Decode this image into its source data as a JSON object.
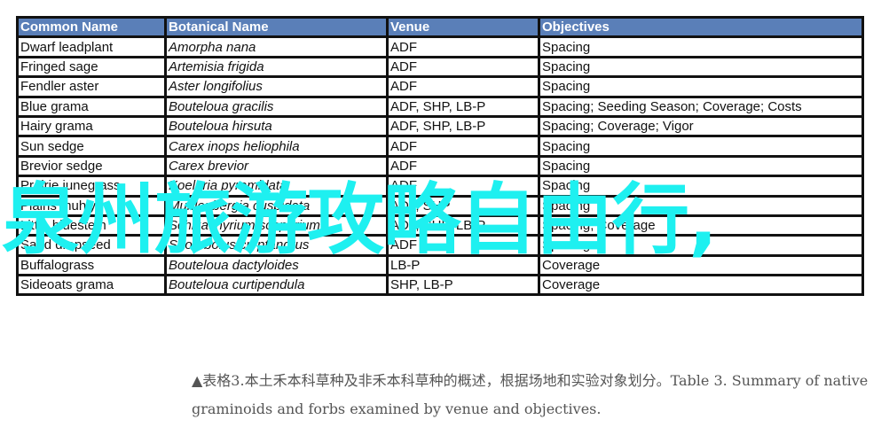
{
  "table": {
    "headers": [
      "Common Name",
      "Botanical  Name",
      "Venue",
      "Objectives"
    ],
    "rows": [
      [
        "Dwarf leadplant",
        "Amorpha nana",
        "ADF",
        "Spacing"
      ],
      [
        "Fringed sage",
        "Artemisia frigida",
        "ADF",
        "Spacing"
      ],
      [
        "Fendler aster",
        "Aster longifolius",
        "ADF",
        "Spacing"
      ],
      [
        "Blue grama",
        "Bouteloua gracilis",
        "ADF, SHP, LB-P",
        "Spacing; Seeding Season;  Coverage; Costs"
      ],
      [
        "Hairy grama",
        "Bouteloua hirsuta",
        "ADF, SHP, LB-P",
        "Spacing; Coverage; Vigor"
      ],
      [
        "Sun sedge",
        "Carex inops heliophila",
        "ADF",
        "Spacing"
      ],
      [
        "Brevior sedge",
        "Carex brevior",
        "ADF",
        "Spacing"
      ],
      [
        "Prairie junegrass",
        "Koeleria pyramidata",
        "ADF",
        "Spacing"
      ],
      [
        "Plains muhly",
        "Muhlenbergia cuspidata",
        "ADF, SHP",
        "Spacing"
      ],
      [
        "Little bluestem",
        "Schizachyrium scoparium",
        "ADF, SHP, LB-P",
        "Spacing; Coverage"
      ],
      [
        "Sand dropseed",
        "Sporobolus cryptandrus",
        "ADF",
        "Spacing"
      ],
      [
        "Buffalograss",
        "Bouteloua dactyloides",
        "LB-P",
        "Coverage"
      ],
      [
        "Sideoats grama",
        "Bouteloua curtipendula",
        "SHP, LB-P",
        "Coverage"
      ]
    ]
  },
  "overlay_text": "泉州旅游攻略自由行,",
  "caption": "▲表格3.本土禾本科草种及非禾本科草种的概述，根据场地和实验对象划分。Table 3. Summary of native graminoids and forbs examined by venue and objectives.",
  "colors": {
    "header_bg": "#5a7fb8",
    "overlay": "#1ef0f0"
  }
}
